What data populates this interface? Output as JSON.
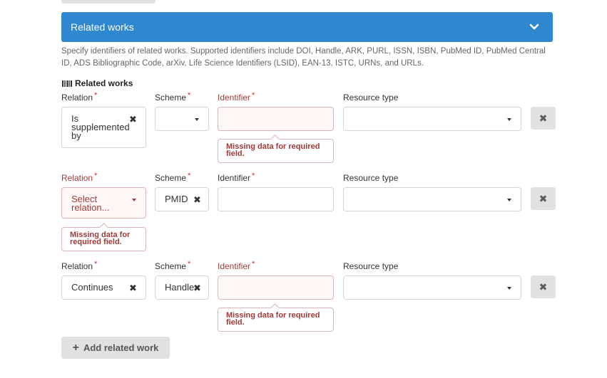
{
  "accordion": {
    "title": "Related works"
  },
  "help_text": "Specify identifiers of related works. Supported identifiers include DOI, Handle, ARK, PURL, ISSN, ISBN, PubMed ID, PubMed Central ID, ADS Bibliographic Code, arXiv, Life Science Identifiers (LSID), EAN-13, ISTC, URNs, and URLs.",
  "section_title": "Related works",
  "labels": {
    "relation": "Relation",
    "scheme": "Scheme",
    "identifier": "Identifier",
    "resource_type": "Resource type",
    "required_mark": "*"
  },
  "rows": [
    {
      "relation_value": "Is supplemented by",
      "relation_lines": [
        "Is",
        "supplemented",
        "by"
      ],
      "scheme_value": "",
      "identifier_value": "",
      "resource_type_value": "",
      "error": "Missing data for required field.",
      "error_lines": [
        "Missing data for required",
        "field."
      ]
    },
    {
      "relation_placeholder": "Select relation...",
      "relation_lines": [
        "Select",
        "relation..."
      ],
      "scheme_value": "PMID",
      "identifier_value": "",
      "resource_type_value": "",
      "error": "Missing data for required field.",
      "error_lines": [
        "Missing data for",
        "required field."
      ]
    },
    {
      "relation_value": "Continues",
      "scheme_value": "Handle",
      "identifier_value": "",
      "resource_type_value": "",
      "error": "Missing data for required field.",
      "error_lines": [
        "Missing data for required",
        "field."
      ]
    }
  ],
  "icons": {
    "clear": "✖",
    "remove": "✖",
    "plus": "+",
    "chevron": "chevron-down-icon",
    "section": "barcode-icon"
  },
  "add_button": {
    "label": "Add related work"
  },
  "colors": {
    "accent": "#2f87d0",
    "error_text": "#9f3a38",
    "error_bg": "#fff6f6",
    "error_border": "#e0b4b4",
    "button_bg": "#e0e1e2"
  }
}
